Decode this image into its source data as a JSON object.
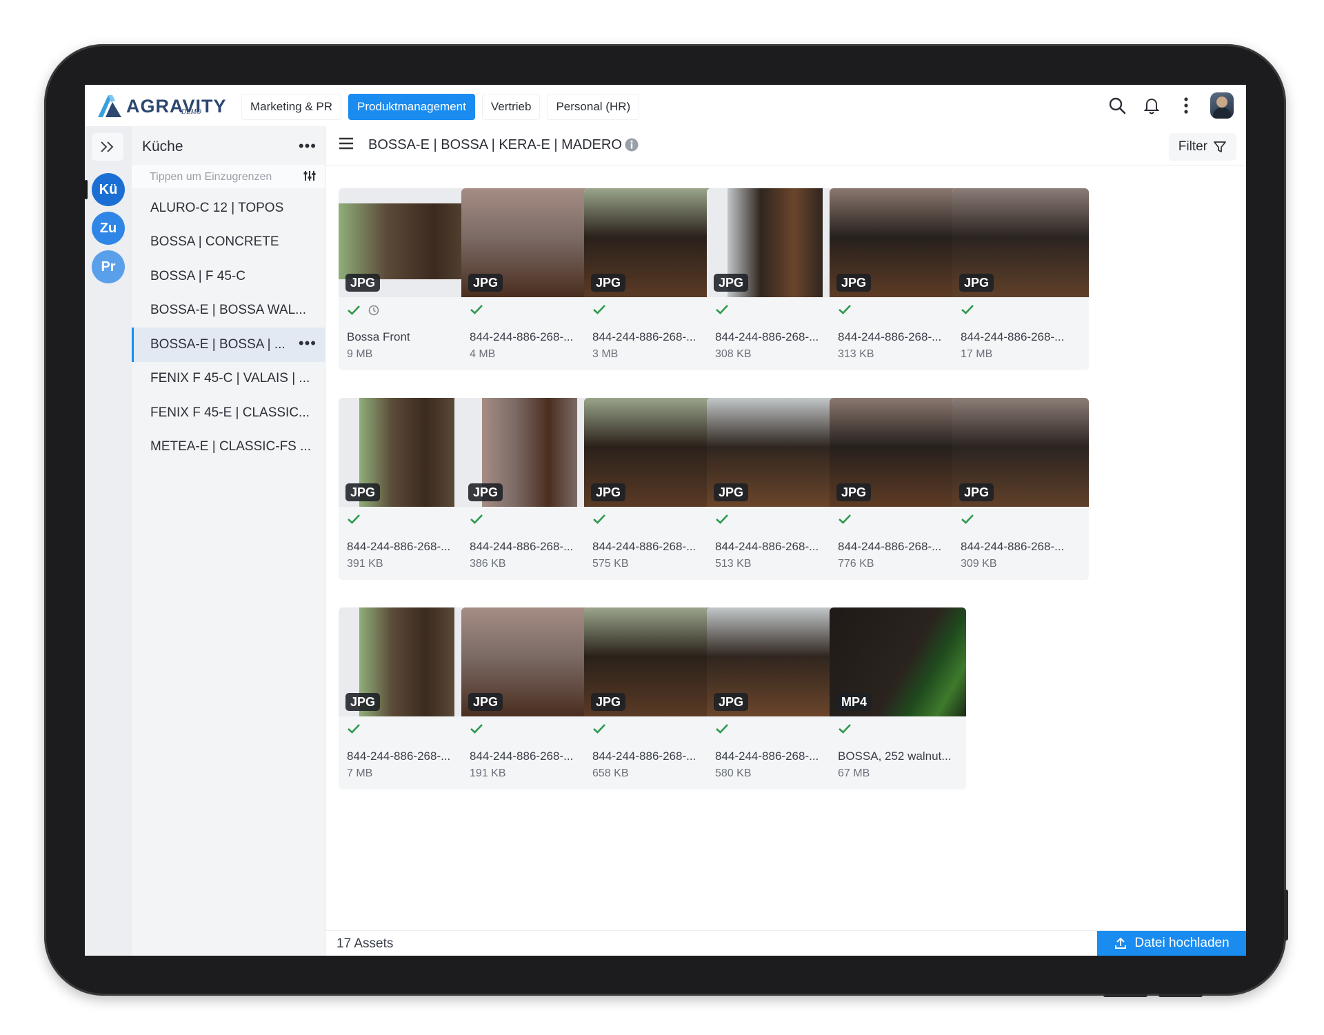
{
  "topbar": {
    "logo_text": "AGRAVITY",
    "logo_sub": "DEMO",
    "tabs": [
      {
        "label": "Marketing & PR"
      },
      {
        "label": "Produktmanagement",
        "active": true
      },
      {
        "label": "Vertrieb"
      },
      {
        "label": "Personal (HR)"
      }
    ],
    "icons": [
      "search-icon",
      "bell-icon",
      "more-vertical-icon",
      "user-avatar"
    ]
  },
  "rail": {
    "workspaces": [
      {
        "label": "Kü",
        "color": "#1b6fd4",
        "active": true
      },
      {
        "label": "Zu",
        "color": "#2f86e6"
      },
      {
        "label": "Pr",
        "color": "#5a9fea"
      }
    ]
  },
  "panel": {
    "title": "Küche",
    "search_placeholder": "Tippen um Einzugrenzen",
    "collections": [
      {
        "label": "ALURO-C 12 | TOPOS"
      },
      {
        "label": "BOSSA | CONCRETE"
      },
      {
        "label": "BOSSA | F 45-C"
      },
      {
        "label": "BOSSA-E | BOSSA WAL..."
      },
      {
        "label": "BOSSA-E | BOSSA | ...",
        "active": true
      },
      {
        "label": "FENIX F 45-C | VALAIS | ..."
      },
      {
        "label": "FENIX F 45-E | CLASSIC..."
      },
      {
        "label": "METEA-E | CLASSIC-FS ..."
      }
    ]
  },
  "main": {
    "breadcrumb": "BOSSA-E | BOSSA | KERA-E | MADERO",
    "filter_label": "Filter",
    "assets": [
      {
        "type": "JPG",
        "name": "Bossa Front",
        "size": "9 MB",
        "extra_icon": true
      },
      {
        "type": "JPG",
        "name": "844-244-886-268-...",
        "size": "4 MB"
      },
      {
        "type": "JPG",
        "name": "844-244-886-268-...",
        "size": "3 MB"
      },
      {
        "type": "JPG",
        "name": "844-244-886-268-...",
        "size": "308 KB"
      },
      {
        "type": "JPG",
        "name": "844-244-886-268-...",
        "size": "313 KB"
      },
      {
        "type": "JPG",
        "name": "844-244-886-268-...",
        "size": "17 MB"
      },
      {
        "type": "JPG",
        "name": "844-244-886-268-...",
        "size": "391 KB"
      },
      {
        "type": "JPG",
        "name": "844-244-886-268-...",
        "size": "386 KB"
      },
      {
        "type": "JPG",
        "name": "844-244-886-268-...",
        "size": "575 KB"
      },
      {
        "type": "JPG",
        "name": "844-244-886-268-...",
        "size": "513 KB"
      },
      {
        "type": "JPG",
        "name": "844-244-886-268-...",
        "size": "776 KB"
      },
      {
        "type": "JPG",
        "name": "844-244-886-268-...",
        "size": "309 KB"
      },
      {
        "type": "JPG",
        "name": "844-244-886-268-...",
        "size": "7 MB"
      },
      {
        "type": "JPG",
        "name": "844-244-886-268-...",
        "size": "191 KB"
      },
      {
        "type": "JPG",
        "name": "844-244-886-268-...",
        "size": "658 KB"
      },
      {
        "type": "JPG",
        "name": "844-244-886-268-...",
        "size": "580 KB"
      },
      {
        "type": "MP4",
        "name": "BOSSA, 252 walnut...",
        "size": "67 MB"
      }
    ]
  },
  "footer": {
    "count_label": "17 Assets",
    "upload_label": "Datei hochladen"
  },
  "colors": {
    "accent": "#1a8cf0",
    "check": "#2e9a4b"
  }
}
